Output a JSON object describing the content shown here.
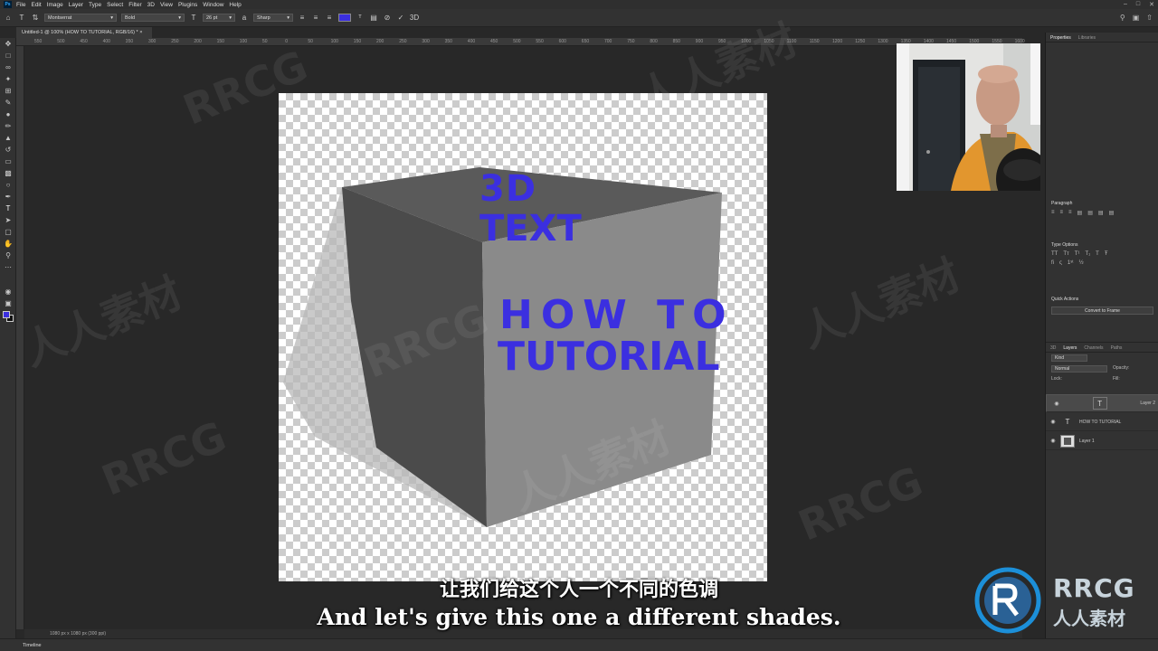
{
  "app": {
    "logo": "Ps"
  },
  "menu": [
    "File",
    "Edit",
    "Image",
    "Layer",
    "Type",
    "Select",
    "Filter",
    "3D",
    "View",
    "Plugins",
    "Window",
    "Help"
  ],
  "options_bar": {
    "font_family": "Montserrat",
    "font_style": "Bold",
    "font_size": "26 pt",
    "antialias": "Sharp",
    "text_color": "#3b2fe0"
  },
  "document": {
    "tab_title": "Untitled-1 @ 100% (HOW TO TUTORIAL, RGB/16) *",
    "status": "1080 px x 1080 px (300 ppi)"
  },
  "ruler": {
    "top_labels": [
      "550",
      "500",
      "450",
      "400",
      "350",
      "300",
      "250",
      "200",
      "150",
      "100",
      "50",
      "0",
      "50",
      "100",
      "150",
      "200",
      "250",
      "300",
      "350",
      "400",
      "450",
      "500",
      "550",
      "600",
      "650",
      "700",
      "750",
      "800",
      "850",
      "900",
      "950",
      "1000",
      "1050",
      "1100",
      "1150",
      "1200",
      "1250",
      "1300",
      "1350",
      "1400",
      "1450",
      "1500",
      "1550",
      "1600"
    ]
  },
  "canvas_text": {
    "line1": "3D",
    "line2": "TEXT",
    "line3": "HOW TO",
    "line4": "TUTORIAL"
  },
  "panels": {
    "top_tabs": [
      "Properties",
      "Libraries"
    ],
    "paragraph_title": "Paragraph",
    "type_options_title": "Type Options",
    "quick_actions_title": "Quick Actions",
    "convert_button": "Convert to Frame",
    "layers_tabs": [
      "3D",
      "Layers",
      "Channels",
      "Paths"
    ],
    "search_placeholder": "Kind",
    "blend_mode": "Normal",
    "opacity_label": "Opacity:",
    "lock_label": "Lock:",
    "fill_label": "Fill:",
    "layers": [
      {
        "name": "Layer 2",
        "type": "text"
      },
      {
        "name": "HOW TO TUTORIAL",
        "type": "text"
      },
      {
        "name": "Layer 1",
        "type": "pixel"
      }
    ]
  },
  "timeline_label": "Timeline",
  "subtitles": {
    "cn": "让我们给这个人一个不同的色调",
    "en": "And let's give this one a different shades."
  },
  "watermark": {
    "latin": "RRCG",
    "cn": "人人素材"
  },
  "brand": {
    "name": "RRCG",
    "cn": "人人素材"
  }
}
